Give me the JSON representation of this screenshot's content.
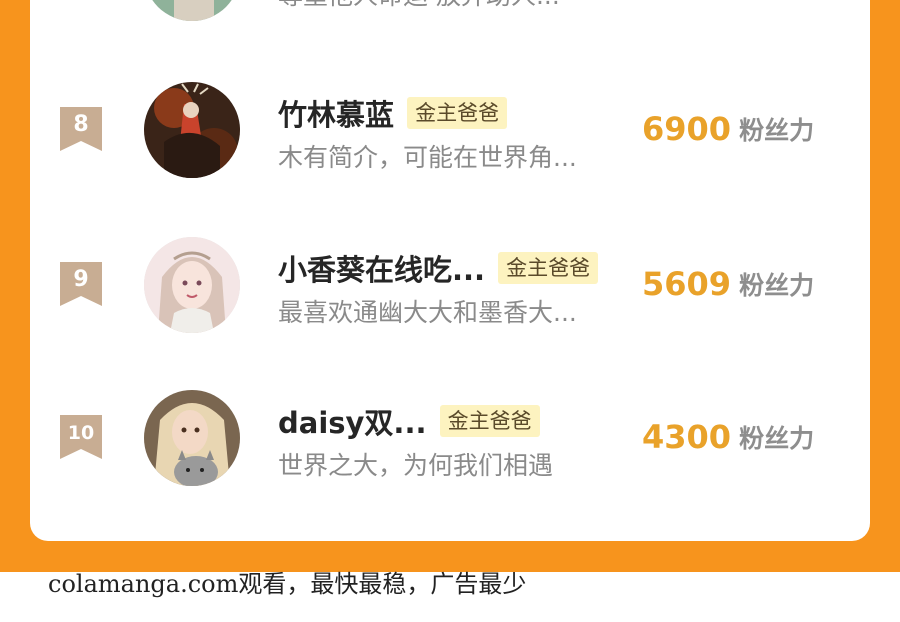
{
  "colors": {
    "frame_orange": "#f7941d",
    "card_bg": "#ffffff",
    "badge_tan": "#c8ad93",
    "tag_bg": "#fdf3c0",
    "score_gold": "#e9a22a"
  },
  "top_partial": {
    "bio": "尊重他人命运 放弃助人..."
  },
  "ranking": [
    {
      "rank": "8",
      "name": "竹林慕蓝",
      "tag": "金主爸爸",
      "bio": "木有简介，可能在世界角...",
      "score": "6900",
      "unit": "粉丝力",
      "avatar_icon": "dark-fantasy-avatar-icon"
    },
    {
      "rank": "9",
      "name": "小香葵在线吃...",
      "tag": "金主爸爸",
      "bio": "最喜欢通幽大大和墨香大...",
      "score": "5609",
      "unit": "粉丝力",
      "avatar_icon": "anime-girl-avatar-icon"
    },
    {
      "rank": "10",
      "name": "daisy双...",
      "tag": "金主爸爸",
      "bio": "世界之大，为何我们相遇",
      "score": "4300",
      "unit": "粉丝力",
      "avatar_icon": "girl-with-cat-avatar-icon"
    }
  ],
  "footer": {
    "watermark": "colamanga.com观看，最快最稳，广告最少"
  }
}
